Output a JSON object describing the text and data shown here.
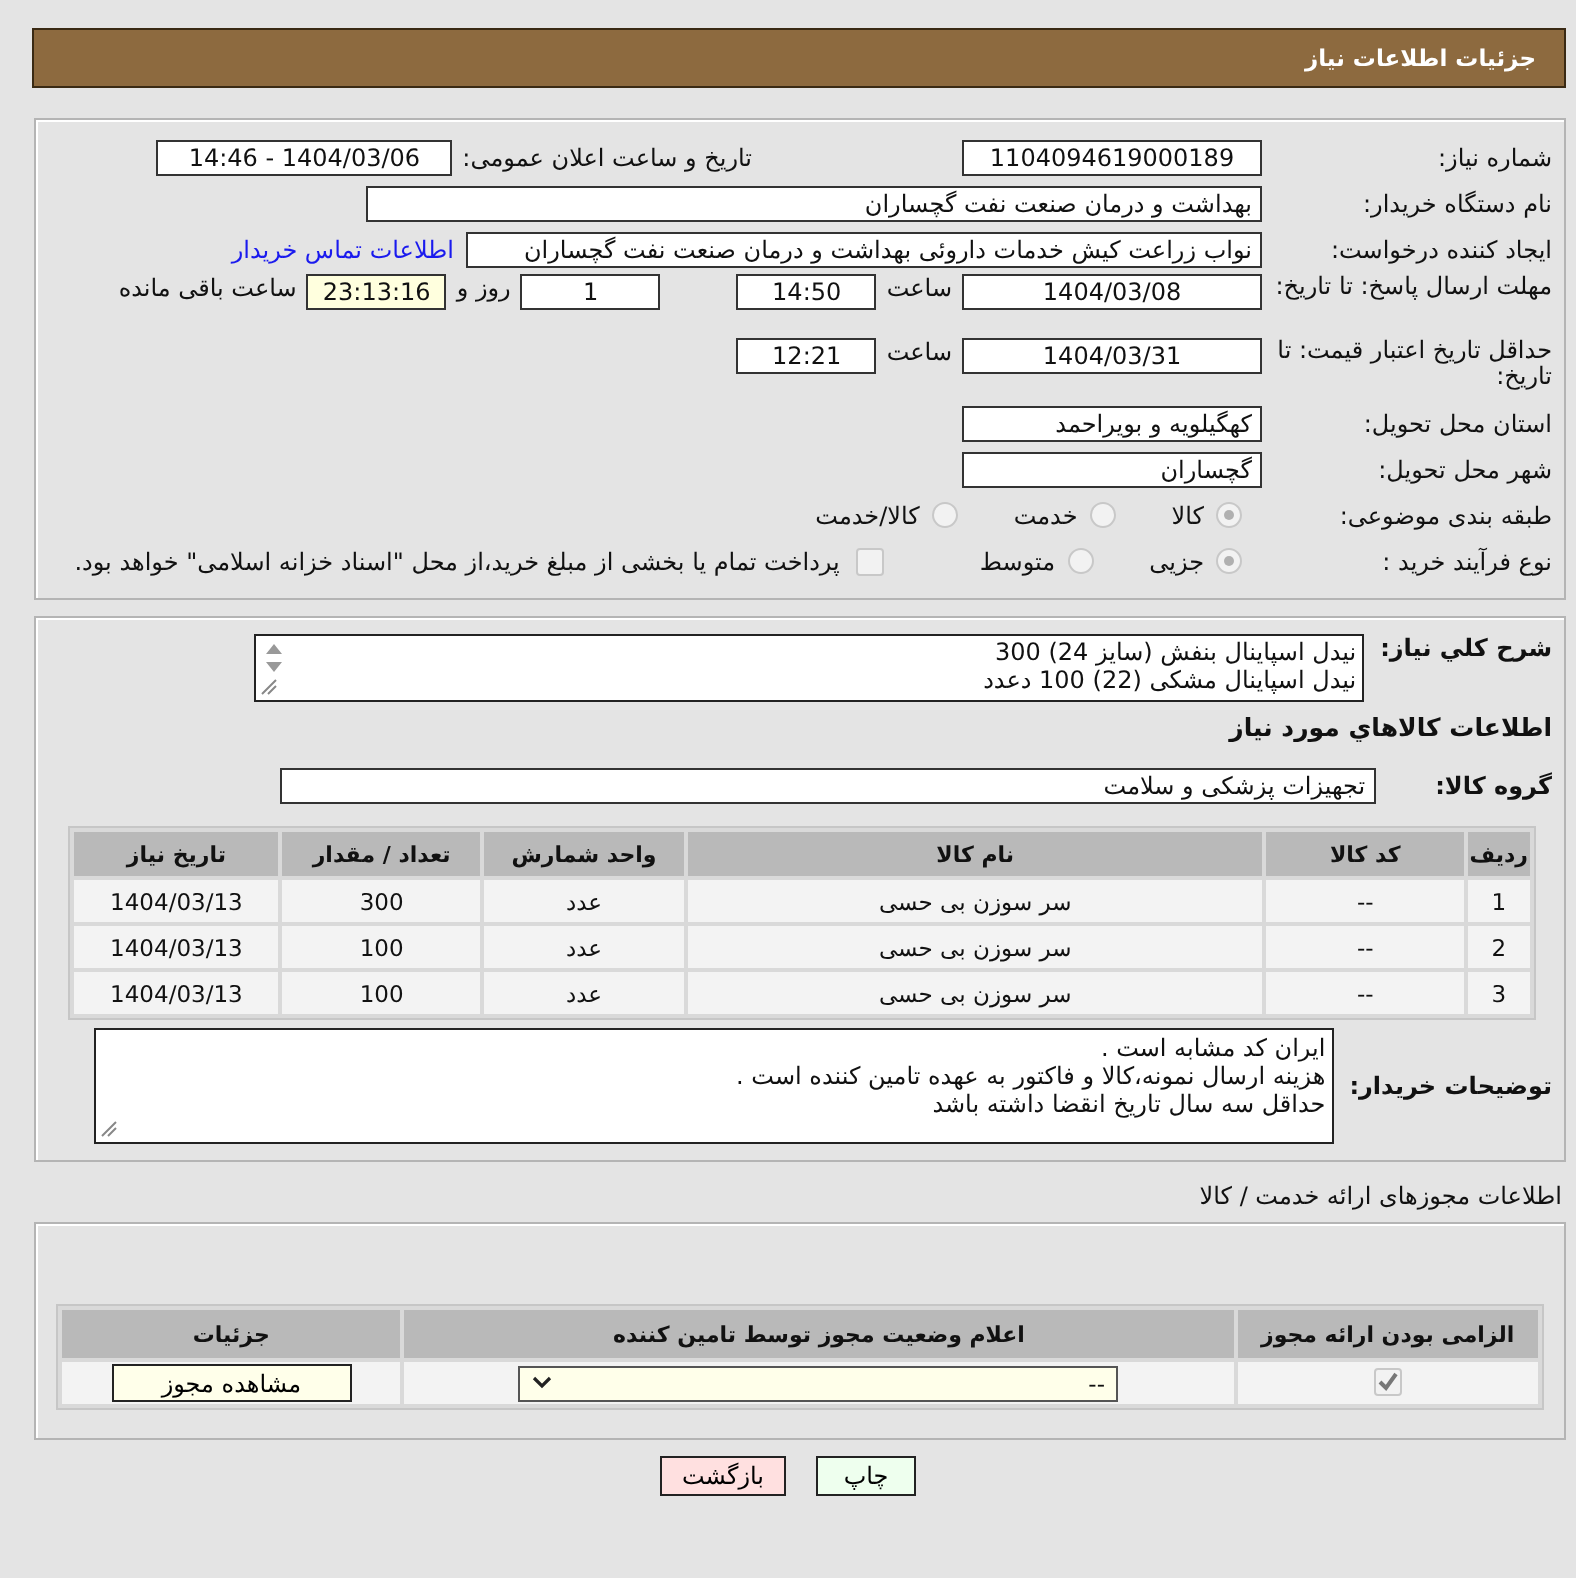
{
  "header": {
    "title": "جزئیات اطلاعات نیاز"
  },
  "need_number": {
    "label": "شماره نیاز:",
    "value": "1104094619000189"
  },
  "announce": {
    "label": "تاریخ و ساعت اعلان عمومی:",
    "value": "1404/03/06 - 14:46"
  },
  "buyer_org": {
    "label": "نام دستگاه خریدار:",
    "value": "بهداشت و درمان صنعت نفت گچساران"
  },
  "requester": {
    "label": "ایجاد کننده درخواست:",
    "value": "نواب زراعت کیش خدمات داروئی بهداشت و درمان صنعت نفت گچساران",
    "link": "اطلاعات تماس خریدار"
  },
  "reply_deadline": {
    "label": "مهلت ارسال پاسخ: تا تاریخ:",
    "date": "1404/03/08",
    "time_label": "ساعت",
    "time": "14:50",
    "days": "1",
    "days_label": "روز و",
    "remaining": "23:13:16",
    "remaining_label": "ساعت باقی مانده"
  },
  "price_validity": {
    "label": "حداقل تاریخ اعتبار قیمت: تا تاریخ:",
    "date": "1404/03/31",
    "time_label": "ساعت",
    "time": "12:21"
  },
  "province": {
    "label": "استان محل تحویل:",
    "value": "کهگیلویه و بویراحمد"
  },
  "city": {
    "label": "شهر محل تحویل:",
    "value": "گچساران"
  },
  "category": {
    "label": "طبقه بندی موضوعی:",
    "options": [
      {
        "label": "کالا",
        "selected": true
      },
      {
        "label": "خدمت",
        "selected": false
      },
      {
        "label": "کالا/خدمت",
        "selected": false
      }
    ]
  },
  "process": {
    "label": "نوع فرآیند خرید :",
    "options": [
      {
        "label": "جزیی",
        "selected": true
      },
      {
        "label": "متوسط",
        "selected": false
      }
    ],
    "payment": {
      "label": "پرداخت تمام یا بخشی از مبلغ خرید،از محل \"اسناد خزانه اسلامی\" خواهد بود.",
      "checked": false
    }
  },
  "description": {
    "label": "شرح كلي نياز:",
    "lines": [
      "نیدل اسپاینال بنفش (سایز 24) 300",
      "نیدل اسپاینال مشکی (22) 100 دعدد"
    ]
  },
  "goods_heading": "اطلاعات كالاهاي مورد نياز",
  "goods_group": {
    "label": "گروه کالا:",
    "value": "تجهیزات پزشکی و سلامت"
  },
  "goods_table": {
    "columns": [
      "ردیف",
      "کد کالا",
      "نام کالا",
      "واحد شمارش",
      "تعداد / مقدار",
      "تاریخ نیاز"
    ],
    "rows": [
      [
        "1",
        "--",
        "سر سوزن بی حسی",
        "عدد",
        "300",
        "1404/03/13"
      ],
      [
        "2",
        "--",
        "سر سوزن بی حسی",
        "عدد",
        "100",
        "1404/03/13"
      ],
      [
        "3",
        "--",
        "سر سوزن بی حسی",
        "عدد",
        "100",
        "1404/03/13"
      ]
    ]
  },
  "buyer_notes": {
    "label": "توضیحات خریدار:",
    "lines": [
      "ایران کد مشابه است .",
      "هزینه ارسال نمونه،کالا و فاکتور به عهده تامین کننده است .",
      "حداقل سه سال تاریخ انقضا داشته باشد"
    ]
  },
  "permits": {
    "title": "اطلاعات مجوزهای ارائه خدمت / کالا",
    "columns": [
      "الزامی بودن ارائه مجوز",
      "اعلام وضعیت مجوز توسط تامین کننده",
      "جزئیات"
    ],
    "rows": [
      {
        "required": true,
        "status": "--",
        "details_button": "مشاهده مجوز"
      }
    ]
  },
  "buttons": [
    {
      "label": "چاپ",
      "kind": "print"
    },
    {
      "label": "بازگشت",
      "kind": "back"
    }
  ]
}
